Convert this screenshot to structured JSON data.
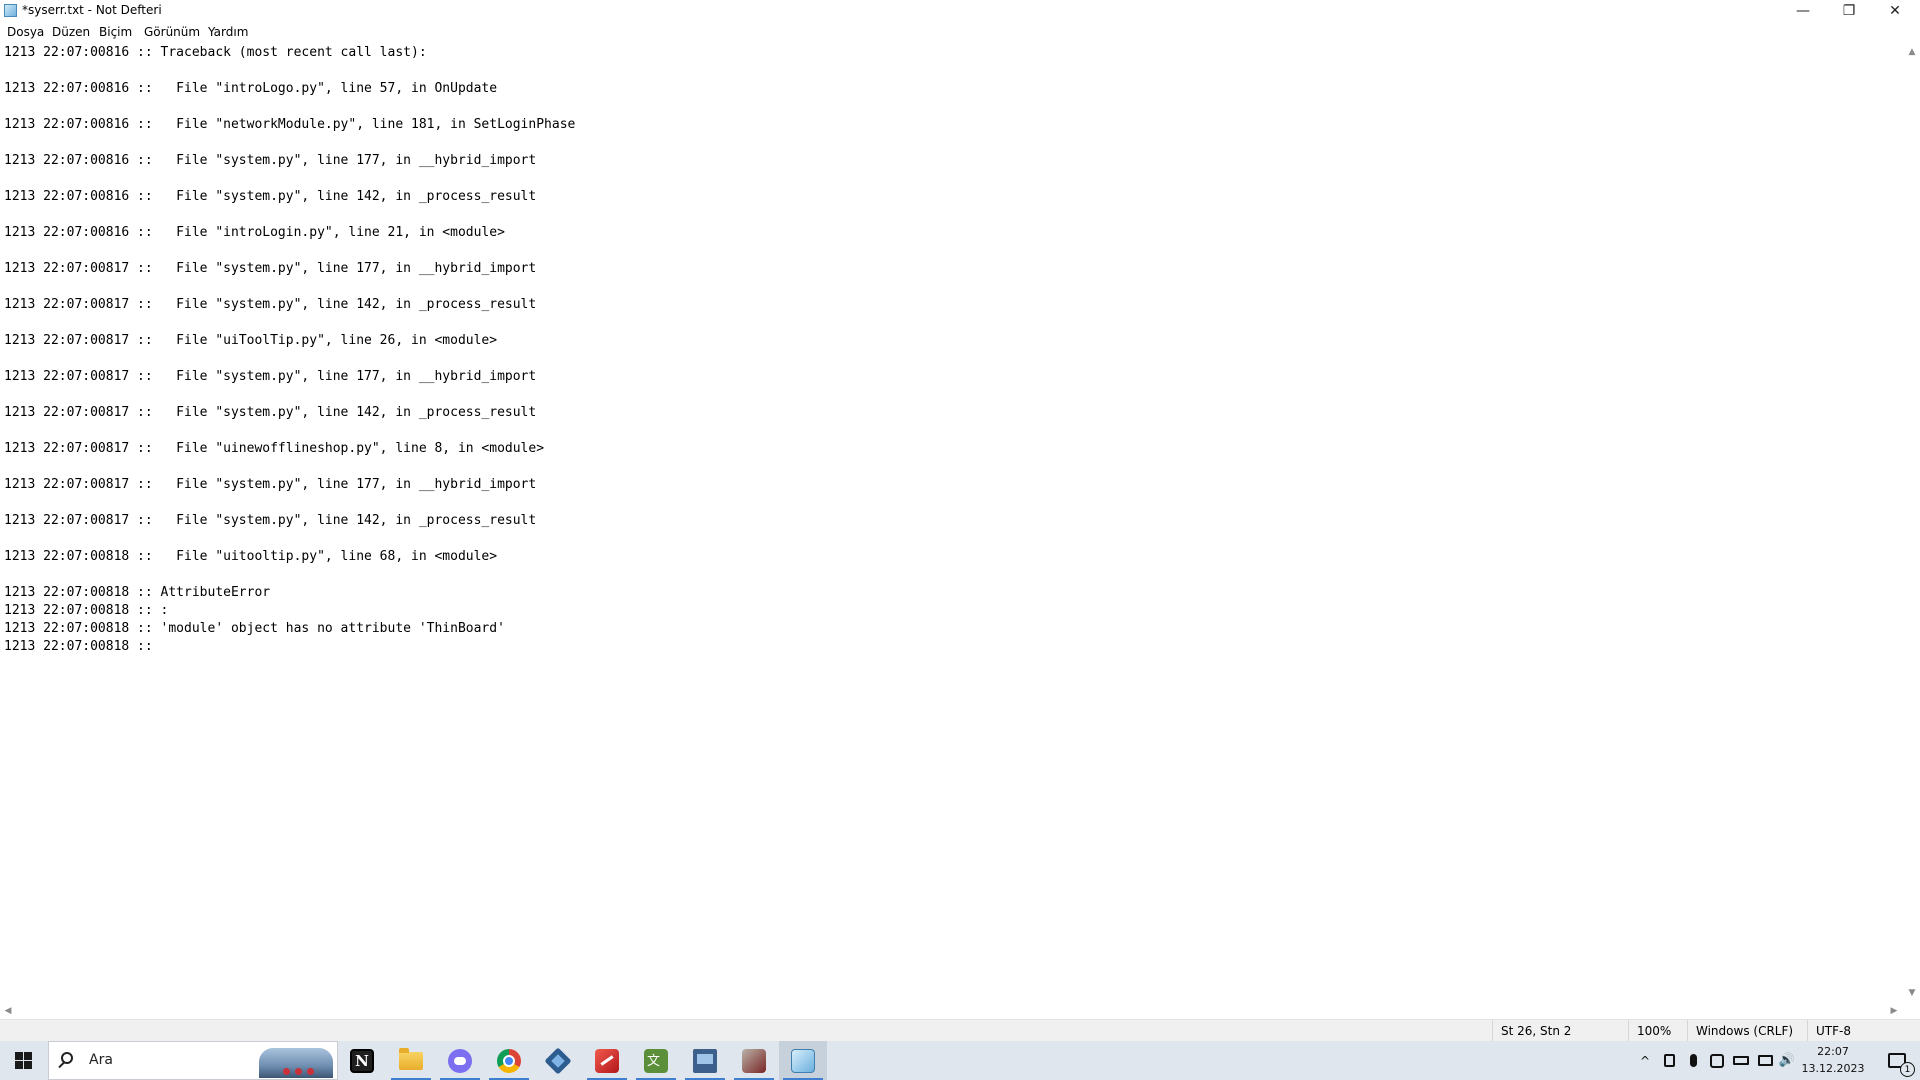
{
  "window": {
    "title": "*syserr.txt - Not Defteri",
    "controls": {
      "minimize": "—",
      "maximize": "❐",
      "close": "✕"
    }
  },
  "menu": [
    "Dosya",
    "Düzen",
    "Biçim",
    "Görünüm",
    "Yardım"
  ],
  "editor": {
    "lines": [
      "1213 22:07:00816 :: Traceback (most recent call last):",
      "",
      "1213 22:07:00816 ::   File \"introLogo.py\", line 57, in OnUpdate",
      "",
      "1213 22:07:00816 ::   File \"networkModule.py\", line 181, in SetLoginPhase",
      "",
      "1213 22:07:00816 ::   File \"system.py\", line 177, in __hybrid_import",
      "",
      "1213 22:07:00816 ::   File \"system.py\", line 142, in _process_result",
      "",
      "1213 22:07:00816 ::   File \"introLogin.py\", line 21, in <module>",
      "",
      "1213 22:07:00817 ::   File \"system.py\", line 177, in __hybrid_import",
      "",
      "1213 22:07:00817 ::   File \"system.py\", line 142, in _process_result",
      "",
      "1213 22:07:00817 ::   File \"uiToolTip.py\", line 26, in <module>",
      "",
      "1213 22:07:00817 ::   File \"system.py\", line 177, in __hybrid_import",
      "",
      "1213 22:07:00817 ::   File \"system.py\", line 142, in _process_result",
      "",
      "1213 22:07:00817 ::   File \"uinewofflineshop.py\", line 8, in <module>",
      "",
      "1213 22:07:00817 ::   File \"system.py\", line 177, in __hybrid_import",
      "",
      "1213 22:07:00817 ::   File \"system.py\", line 142, in _process_result",
      "",
      "1213 22:07:00818 ::   File \"uitooltip.py\", line 68, in <module>",
      "",
      "1213 22:07:00818 :: AttributeError",
      "1213 22:07:00818 :: :",
      "1213 22:07:00818 :: 'module' object has no attribute 'ThinBoard'",
      "1213 22:07:00818 :: "
    ]
  },
  "scroll": {
    "up": "▲",
    "down": "▼",
    "left": "◀",
    "right": "▶"
  },
  "status": {
    "position": "St 26, Stn 2",
    "zoom": "100%",
    "line_ending": "Windows (CRLF)",
    "encoding": "UTF-8"
  },
  "taskbar": {
    "search_placeholder": "Ara",
    "notion_glyph": "N",
    "apps": [
      {
        "name": "notion-icon",
        "active": false
      },
      {
        "name": "file-explorer-icon",
        "active": false
      },
      {
        "name": "discord-icon",
        "active": false
      },
      {
        "name": "chrome-icon",
        "active": false
      },
      {
        "name": "virtualbox-icon",
        "active": false
      },
      {
        "name": "red-app-icon",
        "active": false
      },
      {
        "name": "translator-icon",
        "active": false
      },
      {
        "name": "network-tool-icon",
        "active": false
      },
      {
        "name": "game-client-icon",
        "active": false
      },
      {
        "name": "notepad-icon",
        "active": true
      }
    ],
    "tray_symbols": {
      "chevron": "^",
      "volume": "🔊"
    },
    "clock_time": "22:07",
    "clock_date": "13.12.2023",
    "notification_count": "1"
  }
}
